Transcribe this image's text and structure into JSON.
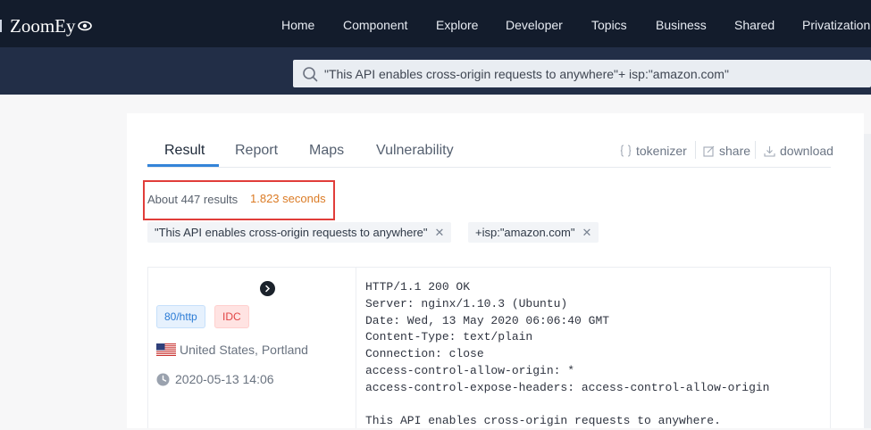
{
  "header": {
    "brand": "ZoomEy",
    "nav": [
      {
        "label": "Home"
      },
      {
        "label": "Component"
      },
      {
        "label": "Explore"
      },
      {
        "label": "Developer"
      },
      {
        "label": "Topics"
      },
      {
        "label": "Business"
      },
      {
        "label": "Shared"
      },
      {
        "label": "Privatization"
      }
    ]
  },
  "search": {
    "query": "\"This API enables cross-origin requests to anywhere\"+ isp:\"amazon.com\""
  },
  "tabs": [
    {
      "label": "Result",
      "active": true
    },
    {
      "label": "Report"
    },
    {
      "label": "Maps"
    },
    {
      "label": "Vulnerability"
    }
  ],
  "tools": {
    "tokenizer": "tokenizer",
    "share": "share",
    "download": "download"
  },
  "results": {
    "count_text": "About 447 results",
    "time_text": "1.823 seconds"
  },
  "filters": [
    {
      "label": "\"This API enables cross-origin requests to anywhere\""
    },
    {
      "label": "+isp:\"amazon.com\""
    }
  ],
  "result_item": {
    "port_badge": "80/http",
    "type_badge": "IDC",
    "location": "United States, Portland",
    "timestamp": "2020-05-13 14:06",
    "banner_lines": [
      "HTTP/1.1 200 OK",
      "Server: nginx/1.10.3 (Ubuntu)",
      "Date: Wed, 13 May 2020 06:06:40 GMT",
      "Content-Type: text/plain",
      "Connection: close",
      "access-control-allow-origin: *",
      "access-control-expose-headers: access-control-allow-origin",
      "",
      "This API enables cross-origin requests to anywhere."
    ]
  },
  "colors": {
    "topbar": "#131c2c",
    "searchbar": "#222e47",
    "accent": "#3484d8",
    "time": "#db7b25",
    "highlight": "#e13d3a"
  }
}
